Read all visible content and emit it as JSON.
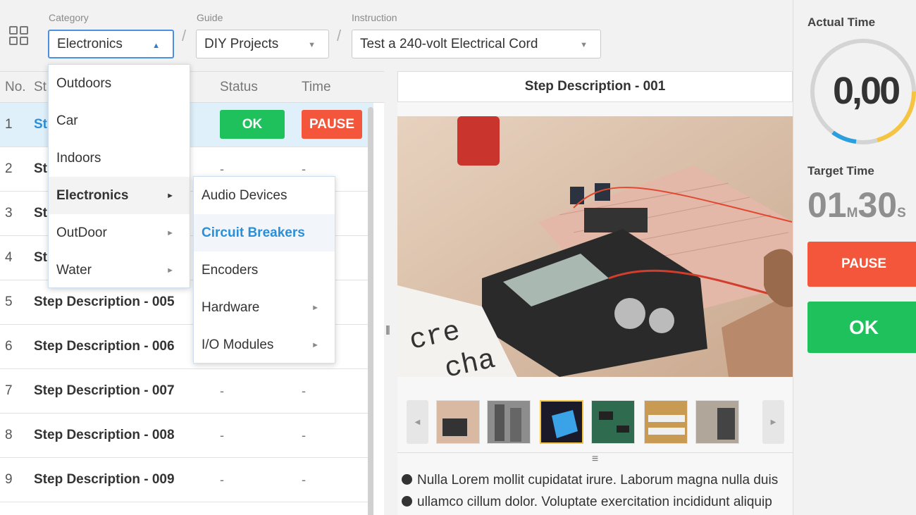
{
  "header": {
    "category_label": "Category",
    "category_value": "Electronics",
    "guide_label": "Guide",
    "guide_value": "DIY Projects",
    "instruction_label": "Instruction",
    "instruction_value": "Test a 240-volt Electrical Cord",
    "separator": "/"
  },
  "category_menu": {
    "items": [
      {
        "label": "Outdoors"
      },
      {
        "label": "Car"
      },
      {
        "label": "Indoors"
      },
      {
        "label": "Electronics",
        "has_submenu": true
      },
      {
        "label": "OutDoor",
        "has_submenu": true
      },
      {
        "label": "Water",
        "has_submenu": true
      }
    ],
    "submenu_arrow": "►"
  },
  "sub_menu": {
    "items": [
      {
        "label": "Audio Devices"
      },
      {
        "label": "Circuit Breakers"
      },
      {
        "label": "Encoders"
      },
      {
        "label": "Hardware",
        "has_submenu": true
      },
      {
        "label": "I/O Modules",
        "has_submenu": true
      }
    ]
  },
  "table": {
    "headers": {
      "no": "No.",
      "step": "St",
      "status": "Status",
      "time": "Time"
    },
    "rows": [
      {
        "no": "1",
        "desc": "St",
        "status_button": "OK",
        "time_button": "PAUSE"
      },
      {
        "no": "2",
        "desc": "St",
        "status": "-",
        "time": "-"
      },
      {
        "no": "3",
        "desc": "St",
        "status": "",
        "time": ""
      },
      {
        "no": "4",
        "desc": "St",
        "status": "",
        "time": ""
      },
      {
        "no": "5",
        "desc": "Step Description - 005",
        "status": "",
        "time": ""
      },
      {
        "no": "6",
        "desc": "Step Description - 006",
        "status": "",
        "time": ""
      },
      {
        "no": "7",
        "desc": "Step Description - 007",
        "status": "-",
        "time": "-"
      },
      {
        "no": "8",
        "desc": "Step Description - 008",
        "status": "-",
        "time": "-"
      },
      {
        "no": "9",
        "desc": "Step Description - 009",
        "status": "-",
        "time": "-"
      }
    ]
  },
  "center": {
    "title": "Step Description - 001",
    "bullets": [
      "Nulla Lorem mollit cupidatat irure. Laborum magna nulla duis",
      "ullamco cillum dolor. Voluptate exercitation incididunt aliquip"
    ],
    "selected_thumbnail": 3
  },
  "right": {
    "actual_time_label": "Actual Time",
    "actual_time_value": "0,00",
    "target_time_label": "Target Time",
    "target_minutes": "01",
    "target_minutes_unit": "M",
    "target_seconds": "30",
    "target_seconds_unit": "S",
    "pause_label": "PAUSE",
    "ok_label": "OK"
  },
  "colors": {
    "accent_blue": "#2a8fd8",
    "ok_green": "#1fc15c",
    "pause_red": "#f4563b",
    "gauge_yellow": "#f5c542",
    "gauge_blue": "#2a9fe0"
  }
}
